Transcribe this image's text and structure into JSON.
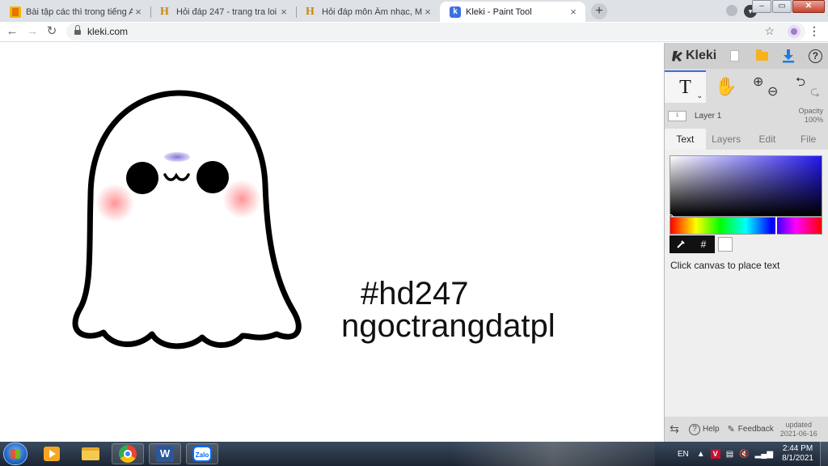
{
  "browser": {
    "tabs": [
      {
        "title": "Bài tập các thì trong tiếng Anh có",
        "favicon": "document-icon",
        "active": false
      },
      {
        "title": "Hỏi đáp 247 - trang tra loi",
        "favicon": "hoidap-icon",
        "active": false
      },
      {
        "title": "Hỏi đáp môn Âm nhạc, Mỹ thuật",
        "favicon": "hoidap-icon",
        "active": false
      },
      {
        "title": "Kleki - Paint Tool",
        "favicon": "kleki-icon",
        "active": true
      }
    ],
    "tab_close_glyph": "×",
    "new_tab_glyph": "+",
    "profile_initial": "▾",
    "url": "kleki.com",
    "window_controls": {
      "minimize": "–",
      "maximize": "▭",
      "close": "✕"
    }
  },
  "canvas": {
    "texts": [
      "#hd247",
      "ngoctrangdatpl"
    ],
    "drawing": "ghost",
    "colors": {
      "outline": "#000000",
      "blush": "#ff8f93",
      "eyebrow": "#7b6fd6"
    }
  },
  "kleki": {
    "logo_text": "Kleki",
    "tools": {
      "text_glyph": "T",
      "dropdown_glyph": "⌄",
      "hand_glyph": "✋",
      "zoom_in_glyph": "⊕",
      "zoom_out_glyph": "⊖",
      "undo_glyph": "⮌",
      "redo_glyph": "⮎"
    },
    "layer": {
      "thumb_label": "1",
      "name": "Layer 1",
      "opacity_label": "Opacity",
      "opacity_value": "100%"
    },
    "tabs": [
      "Text",
      "Layers",
      "Edit",
      "File"
    ],
    "active_tab": "Text",
    "color_picker": {
      "hue_color": "#2318ef",
      "current_color": "#ffffff"
    },
    "color_tools": {
      "eyedropper_glyph": "⁄",
      "hex_glyph": "#"
    },
    "hint": "Click canvas to place text",
    "footer": {
      "swap_glyph": "⇆",
      "help_label": "Help",
      "help_glyph": "?",
      "feedback_label": "Feedback",
      "updated_label": "updated",
      "updated_date": "2021-06-16"
    }
  },
  "taskbar": {
    "apps": [
      "media-player-icon",
      "file-explorer-icon",
      "chrome-icon",
      "word-icon",
      "zalo-icon"
    ],
    "word_letter": "W",
    "zalo_label": "Zalo",
    "tray": {
      "language": "EN",
      "caret_glyph": "▲",
      "antivirus_letter": "V",
      "time": "2:44 PM",
      "date": "8/1/2021"
    }
  }
}
